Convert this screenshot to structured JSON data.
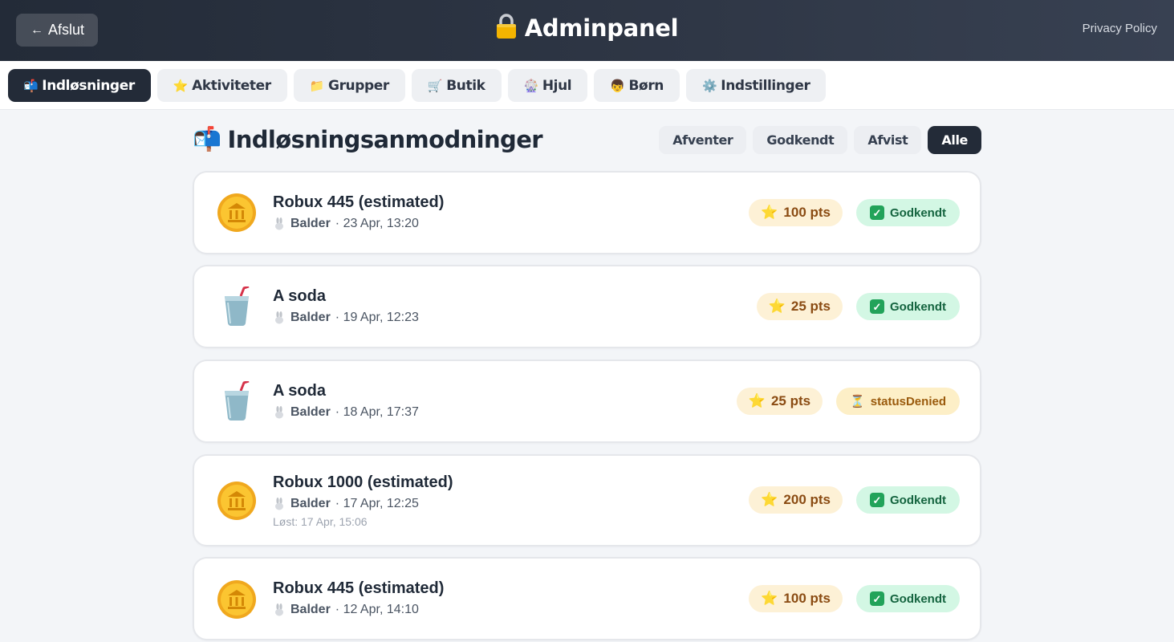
{
  "header": {
    "back_label": "Afslut",
    "title": "Adminpanel",
    "privacy_link": "Privacy Policy"
  },
  "tabs": [
    {
      "label": "Indløsninger",
      "icon": "mailbox-icon",
      "active": true
    },
    {
      "label": "Aktiviteter",
      "icon": "star-icon",
      "active": false
    },
    {
      "label": "Grupper",
      "icon": "folder-icon",
      "active": false
    },
    {
      "label": "Butik",
      "icon": "cart-icon",
      "active": false
    },
    {
      "label": "Hjul",
      "icon": "ferris-wheel-icon",
      "active": false
    },
    {
      "label": "Børn",
      "icon": "boy-icon",
      "active": false
    },
    {
      "label": "Indstillinger",
      "icon": "gear-icon",
      "active": false
    }
  ],
  "page": {
    "title": "Indløsningsanmodninger",
    "filters": [
      {
        "label": "Afventer",
        "active": false
      },
      {
        "label": "Godkendt",
        "active": false
      },
      {
        "label": "Afvist",
        "active": false
      },
      {
        "label": "Alle",
        "active": true
      }
    ]
  },
  "redemptions": [
    {
      "name": "Robux 445 (estimated)",
      "icon": "coin-icon",
      "user": "Balder",
      "date": "· 23 Apr, 13:20",
      "resolved": "",
      "points": "100 pts",
      "status": "Godkendt",
      "status_type": "approved"
    },
    {
      "name": "A soda",
      "icon": "cup-icon",
      "user": "Balder",
      "date": "· 19 Apr, 12:23",
      "resolved": "",
      "points": "25 pts",
      "status": "Godkendt",
      "status_type": "approved"
    },
    {
      "name": "A soda",
      "icon": "cup-icon",
      "user": "Balder",
      "date": "· 18 Apr, 17:37",
      "resolved": "",
      "points": "25 pts",
      "status": "statusDenied",
      "status_type": "pending"
    },
    {
      "name": "Robux 1000 (estimated)",
      "icon": "coin-icon",
      "user": "Balder",
      "date": "· 17 Apr, 12:25",
      "resolved": "Løst: 17 Apr, 15:06",
      "points": "200 pts",
      "status": "Godkendt",
      "status_type": "approved"
    },
    {
      "name": "Robux 445 (estimated)",
      "icon": "coin-icon",
      "user": "Balder",
      "date": "· 12 Apr, 14:10",
      "resolved": "",
      "points": "100 pts",
      "status": "Godkendt",
      "status_type": "approved"
    }
  ],
  "colors": {
    "header_bg": "#2f3746",
    "active_tab_bg": "#232b38",
    "points_bg": "#fdf1d6",
    "approved_bg": "#d3f7e4",
    "pending_bg": "#fdefc7"
  }
}
